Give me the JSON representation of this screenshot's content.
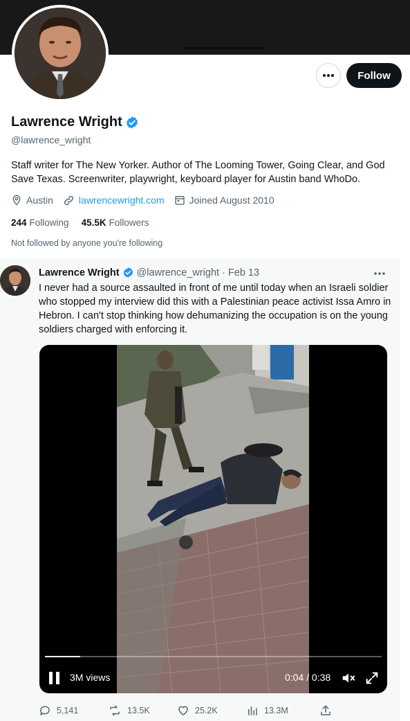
{
  "profile": {
    "name": "Lawrence Wright",
    "handle": "@lawrence_wright",
    "bio": "Staff writer for The New Yorker. Author of The Looming Tower, Going Clear, and God Save Texas. Screenwriter, playwright, keyboard player for Austin band WhoDo.",
    "location": "Austin",
    "website": "lawrencewright.com",
    "joined": "Joined August 2010",
    "following_count": "244",
    "following_label": "Following",
    "followers_count": "45.5K",
    "followers_label": "Followers",
    "not_followed_text": "Not followed by anyone you're following",
    "follow_button": "Follow",
    "verified": true
  },
  "tweet": {
    "author_name": "Lawrence Wright",
    "author_handle": "@lawrence_wright",
    "separator": "·",
    "date": "Feb 13",
    "text": "I never had a source assaulted in front of me until today when an Israeli soldier who stopped my interview did this with a Palestinian peace activist Issa Amro in Hebron. I can't stop thinking how dehumanizing the occupation is on the young soldiers charged with enforcing it.",
    "video": {
      "views": "3M views",
      "time": "0:04 / 0:38",
      "progress": 0.105
    },
    "stats": {
      "replies": "5,141",
      "retweets": "13.5K",
      "likes": "25.2K",
      "views": "13.3M"
    }
  },
  "colors": {
    "accent": "#1d9bf0",
    "text": "#0f1419",
    "muted": "#536471",
    "banner": "#181818"
  }
}
